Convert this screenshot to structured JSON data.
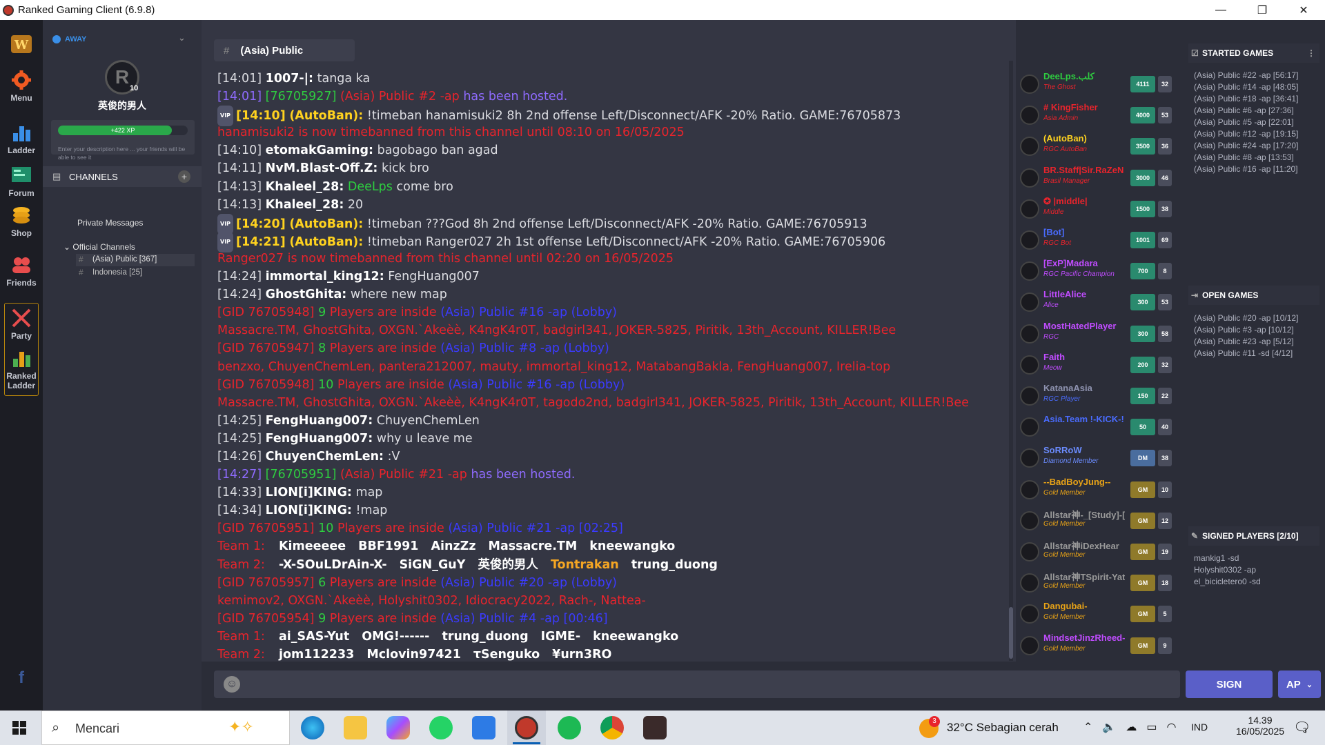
{
  "window": {
    "title": "Ranked Gaming Client (6.9.8)",
    "minimize": "—",
    "restore": "❐",
    "close": "✕"
  },
  "nav": [
    {
      "label": "Menu",
      "icon": "gear-icon"
    },
    {
      "label": "Ladder",
      "icon": "bar-chart-icon"
    },
    {
      "label": "Forum",
      "icon": "forum-icon"
    },
    {
      "label": "Shop",
      "icon": "coins-icon"
    },
    {
      "label": "Friends",
      "icon": "friends-icon"
    },
    {
      "label": "Party",
      "icon": "swords-icon"
    },
    {
      "label": "Ranked Ladder",
      "icon": "ranked-ladder-icon"
    }
  ],
  "profile": {
    "status": "AWAY",
    "level": "10",
    "username": "英俊的男人",
    "xp": "+422 XP",
    "xp_progress": 0.88,
    "description_placeholder": "Enter your description here ... your friends will be able to see it",
    "channels_title": "CHANNELS",
    "private_messages": "Private Messages",
    "official_channels": "Official Channels",
    "channels": [
      {
        "name": "(Asia) Public [367]"
      },
      {
        "name": "Indonesia [25]"
      }
    ]
  },
  "chat": {
    "channel": "(Asia) Public",
    "line0": {
      "ts": "[14:01]",
      "user": "1007-|:",
      "msg": "tanga ka"
    },
    "line1": {
      "ts": "[14:01]",
      "gid": "[76705927]",
      "game": "(Asia) Public #2 -ap",
      "msg": "has been hosted."
    },
    "line2": {
      "vip": "VIP",
      "ts": "[14:10]",
      "user": "(AutoBan):",
      "msg": "!timeban hanamisuki2 8h 2nd offense Left/Disconnect/AFK -20% Ratio. GAME:76705873"
    },
    "line3": {
      "msg": "hanamisuki2 is now timebanned from this channel until 08:10 on 16/05/2025"
    },
    "line4": {
      "ts": "[14:10]",
      "user": "etomakGaming:",
      "msg": "bagobago ban agad"
    },
    "line5": {
      "ts": "[14:11]",
      "user": "NvM.Blast-Off.Z:",
      "msg": "kick bro"
    },
    "line6": {
      "ts": "[14:13]",
      "user": "Khaleel_28:",
      "mention": "DeeLps",
      "msg": "come bro"
    },
    "line7": {
      "ts": "[14:13]",
      "user": "Khaleel_28:",
      "msg": "20"
    },
    "line8": {
      "vip": "VIP",
      "ts": "[14:20]",
      "user": "(AutoBan):",
      "msg": "!timeban ???God 8h 2nd offense Left/Disconnect/AFK -20% Ratio. GAME:76705913"
    },
    "line9": {
      "vip": "VIP",
      "ts": "[14:21]",
      "user": "(AutoBan):",
      "msg": "!timeban Ranger027 2h 1st offense Left/Disconnect/AFK -20% Ratio. GAME:76705906"
    },
    "line10": {
      "msg": "Ranger027 is now timebanned from this channel until 02:20 on 16/05/2025"
    },
    "line11": {
      "ts": "[14:24]",
      "user": "immortal_king12:",
      "msg": "FengHuang007"
    },
    "line12": {
      "ts": "[14:24]",
      "user": "GhostGhita:",
      "msg": "where new map"
    },
    "line13": {
      "gid": "[GID 76705948]",
      "count": "9",
      "inside": "Players are inside",
      "game": "(Asia) Public #16 -ap (Lobby)"
    },
    "line14": {
      "msg": "Massacre.TM, GhostGhita, OXGN.`Akeèè, K4ngK4r0T, badgirl341, JOKER-5825, Piritik, 13th_Account, KILLER!Bee"
    },
    "line15": {
      "gid": "[GID 76705947]",
      "count": "8",
      "inside": "Players are inside",
      "game": "(Asia) Public #8 -ap (Lobby)"
    },
    "line16": {
      "msg": "benzxo, ChuyenChemLen, pantera212007, mauty, immortal_king12, MatabangBakla, FengHuang007, Irelia-top"
    },
    "line17": {
      "gid": "[GID 76705948]",
      "count": "10",
      "inside": "Players are inside",
      "game": "(Asia) Public #16 -ap (Lobby)"
    },
    "line18": {
      "msg": "Massacre.TM, GhostGhita, OXGN.`Akeèè, K4ngK4r0T, tagodo2nd, badgirl341, JOKER-5825, Piritik, 13th_Account, KILLER!Bee"
    },
    "line19": {
      "ts": "[14:25]",
      "user": "FengHuang007:",
      "msg": "ChuyenChemLen"
    },
    "line20": {
      "ts": "[14:25]",
      "user": "FengHuang007:",
      "msg": "why u leave me"
    },
    "line21": {
      "ts": "[14:26]",
      "user": "ChuyenChemLen:",
      "msg": ":V"
    },
    "line22": {
      "ts": "[14:27]",
      "gid": "[76705951]",
      "game": "(Asia) Public #21 -ap",
      "msg": "has been hosted."
    },
    "line23": {
      "ts": "[14:33]",
      "user": "LION[i]KING:",
      "msg": "map"
    },
    "line24": {
      "ts": "[14:34]",
      "user": "LION[i]KING:",
      "msg": "!map"
    },
    "line25": {
      "gid": "[GID 76705951]",
      "count": "10",
      "inside": "Players are inside",
      "game": "(Asia) Public #21 -ap [02:25]"
    },
    "line26": {
      "team": "Team 1:",
      "p1": "Kimeeeee",
      "p2": "BBF1991",
      "p3": "AinzZz",
      "p4": "Massacre.TM",
      "p5": "kneewangko"
    },
    "line27": {
      "team": "Team 2:",
      "p1": "-X-SOuLDrAin-X-",
      "p2": "SiGN_GuY",
      "p3": "英俊的男人",
      "p4": "Tontrakan",
      "p5": "trung_duong"
    },
    "line28": {
      "gid": "[GID 76705957]",
      "count": "6",
      "inside": "Players are inside",
      "game": "(Asia) Public #20 -ap (Lobby)"
    },
    "line29": {
      "msg": "kemimov2, OXGN.`Akeèè, Holyshit0302, Idiocracy2022, Rach-, Nattea-"
    },
    "line30": {
      "gid": "[GID 76705954]",
      "count": "9",
      "inside": "Players are inside",
      "game": "(Asia) Public #4 -ap [00:46]"
    },
    "line31": {
      "team": "Team 1:",
      "p1": "ai_SAS-Yut",
      "p2": "OMG!------",
      "p3": "trung_duong",
      "p4": "IGME-",
      "p5": "kneewangko"
    },
    "line32": {
      "team": "Team 2:",
      "p1": "jom112233",
      "p2": "Mclovin97421",
      "p3": "τSenguko",
      "p4": "¥urn3RO"
    }
  },
  "players": [
    {
      "name": "DeeLps.كلب",
      "role": "The Ghost",
      "b1": "4111",
      "b2": "32",
      "color": "#2ecc40",
      "rolecolor": "#e8242c",
      "b1color": "#2a8a6e"
    },
    {
      "name": "# KingFisher",
      "role": "Asia Admin",
      "b1": "4000",
      "b2": "53",
      "color": "#e8242c",
      "rolecolor": "#e8242c",
      "b1color": "#2a8a6e"
    },
    {
      "name": "(AutoBan)",
      "role": "RGC AutoBan",
      "b1": "3500",
      "b2": "36",
      "color": "#ffd21f",
      "rolecolor": "#e8242c",
      "b1color": "#2a8a6e"
    },
    {
      "name": "BR.Staff|Sir.RaZeN",
      "role": "Brasil Manager",
      "b1": "3000",
      "b2": "46",
      "color": "#e8242c",
      "rolecolor": "#e8242c",
      "b1color": "#2a8a6e"
    },
    {
      "name": "✪ |middle|",
      "role": "Middle",
      "b1": "1500",
      "b2": "38",
      "color": "#e8242c",
      "rolecolor": "#e8242c",
      "b1color": "#2a8a6e"
    },
    {
      "name": "[Bot]",
      "role": "RGC Bot",
      "b1": "1001",
      "b2": "69",
      "color": "#4a6cff",
      "rolecolor": "#e8242c",
      "b1color": "#2a8a6e"
    },
    {
      "name": "[ExP]Madara",
      "role": "RGC Pacific Champion",
      "b1": "700",
      "b2": "8",
      "color": "#c04cff",
      "rolecolor": "#c04cff",
      "b1color": "#2a8a6e"
    },
    {
      "name": "LittleAlice",
      "role": "Alice",
      "b1": "300",
      "b2": "53",
      "color": "#c04cff",
      "rolecolor": "#c04cff",
      "b1color": "#2a8a6e"
    },
    {
      "name": "MostHatedPlayer",
      "role": "RGC",
      "b1": "300",
      "b2": "58",
      "color": "#c04cff",
      "rolecolor": "#c04cff",
      "b1color": "#2a8a6e"
    },
    {
      "name": "Faith",
      "role": "Meow",
      "b1": "200",
      "b2": "32",
      "color": "#c04cff",
      "rolecolor": "#c04cff",
      "b1color": "#2a8a6e"
    },
    {
      "name": "KatanaAsia",
      "role": "RGC Player",
      "b1": "150",
      "b2": "22",
      "color": "#8f93b0",
      "rolecolor": "#4a6cff",
      "b1color": "#2a8a6e"
    },
    {
      "name": "Asia.Team !-KICK-!",
      "role": "",
      "b1": "50",
      "b2": "40",
      "color": "#4a6cff",
      "rolecolor": "#4a6cff",
      "b1color": "#2a8a6e"
    },
    {
      "name": "SoRRoW",
      "role": "Diamond Member",
      "b1": "DM",
      "b2": "38",
      "color": "#6b8cff",
      "rolecolor": "#6b8cff",
      "b1color": "#4a6d9e"
    },
    {
      "name": "--BadBoyJung--",
      "role": "Gold Member",
      "b1": "GM",
      "b2": "10",
      "color": "#e8a317",
      "rolecolor": "#e8a317",
      "b1color": "#8f7a2a"
    },
    {
      "name": "Allstar神-_[Study]-[",
      "role": "Gold Member",
      "b1": "GM",
      "b2": "12",
      "color": "#9a9a9a",
      "rolecolor": "#e8a317",
      "b1color": "#8f7a2a"
    },
    {
      "name": "Allstar神iDexHear",
      "role": "Gold Member",
      "b1": "GM",
      "b2": "19",
      "color": "#9a9a9a",
      "rolecolor": "#e8a317",
      "b1color": "#8f7a2a"
    },
    {
      "name": "Allstar神TSpirit-Yat",
      "role": "Gold Member",
      "b1": "GM",
      "b2": "18",
      "color": "#9a9a9a",
      "rolecolor": "#e8a317",
      "b1color": "#8f7a2a"
    },
    {
      "name": "Dangubai-",
      "role": "Gold Member",
      "b1": "GM",
      "b2": "5",
      "color": "#e8a317",
      "rolecolor": "#e8a317",
      "b1color": "#8f7a2a"
    },
    {
      "name": "MindsetJinzRheed-",
      "role": "Gold Member",
      "b1": "GM",
      "b2": "9",
      "color": "#c04cff",
      "rolecolor": "#e8a317",
      "b1color": "#8f7a2a"
    }
  ],
  "started_games": {
    "title": "STARTED GAMES",
    "items": [
      "(Asia) Public #22 -ap [56:17]",
      "(Asia) Public #14 -ap [48:05]",
      "(Asia) Public #18 -ap [36:41]",
      "(Asia) Public #6 -ap [27:36]",
      "(Asia) Public #5 -ap [22:01]",
      "(Asia) Public #12 -ap [19:15]",
      "(Asia) Public #24 -ap [17:20]",
      "(Asia) Public #8 -ap [13:53]",
      "(Asia) Public #16 -ap [11:20]"
    ]
  },
  "open_games": {
    "title": "OPEN GAMES",
    "items": [
      "(Asia) Public #20 -ap [10/12]",
      "(Asia) Public #3 -ap [10/12]",
      "(Asia) Public #23 -ap [5/12]",
      "(Asia) Public #11 -sd [4/12]"
    ]
  },
  "signed_players": {
    "title": "SIGNED PLAYERS [2/10]",
    "items": [
      "mankig1 -sd",
      "Holyshit0302 -ap",
      "el_bicicletero0 -sd"
    ]
  },
  "buttons": {
    "sign": "SIGN",
    "ap": "AP"
  },
  "taskbar": {
    "search": "Mencari",
    "weather": "32°C  Sebagian cerah",
    "lang": "IND",
    "time": "14.39",
    "date": "16/05/2025",
    "badge": "3",
    "notif": "3"
  }
}
